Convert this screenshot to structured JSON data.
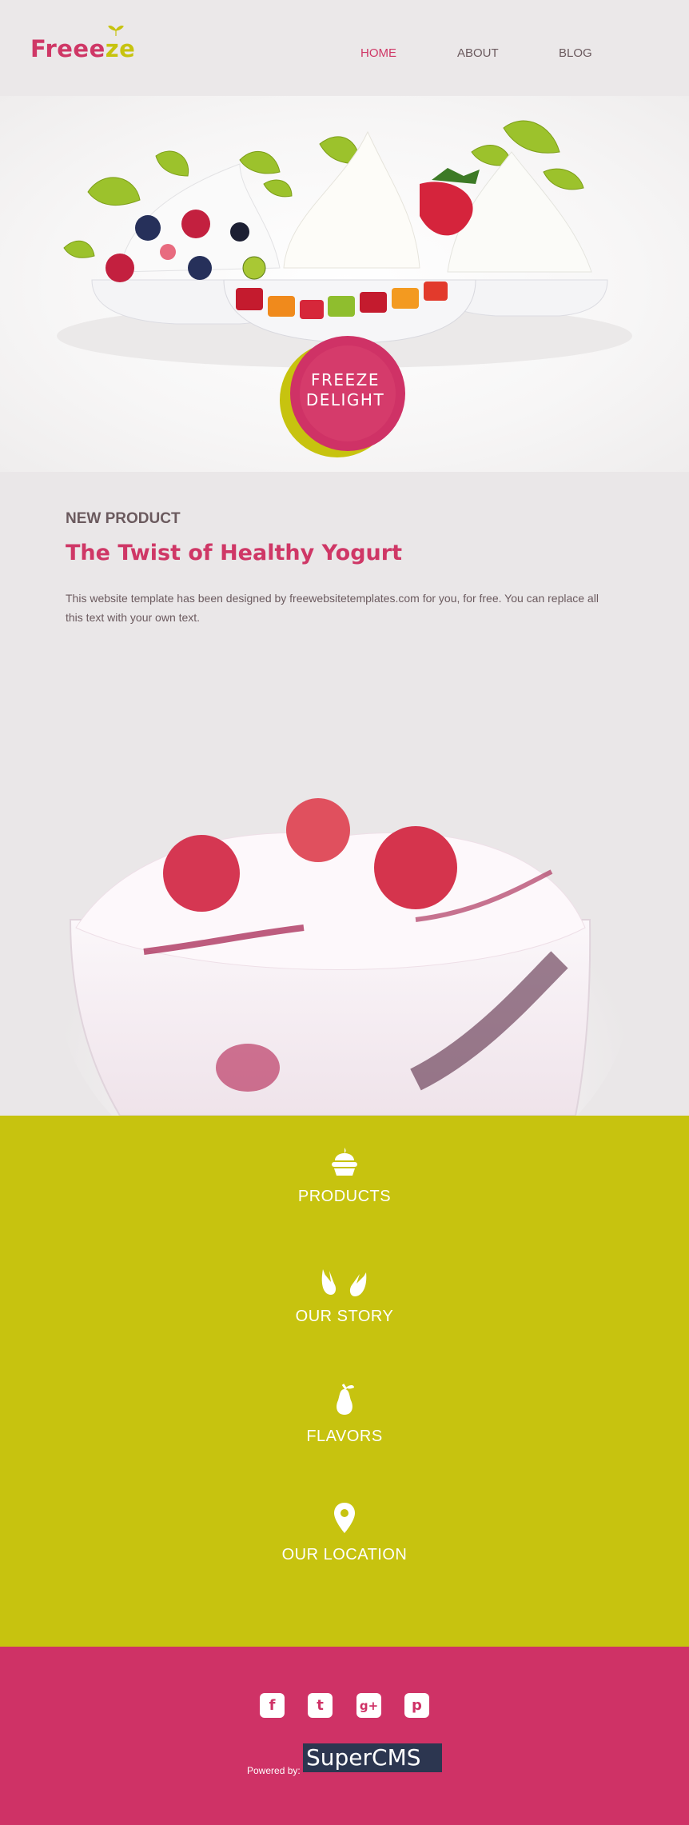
{
  "header": {
    "logo_main": "Freee",
    "logo_accent": "ze",
    "nav": [
      {
        "label": "HOME",
        "active": true
      },
      {
        "label": "ABOUT",
        "active": false
      },
      {
        "label": "BLOG",
        "active": false
      }
    ]
  },
  "hero": {
    "badge_line1": "FREEZE",
    "badge_line2": "DELIGHT"
  },
  "product": {
    "kicker": "NEW PRODUCT",
    "title": "The Twist of Healthy Yogurt",
    "description": "This website template has been designed by freewebsitetemplates.com for you, for free. You can replace all this text with your own text."
  },
  "links": [
    {
      "label": "PRODUCTS",
      "icon": "cupcake-icon"
    },
    {
      "label": "OUR STORY",
      "icon": "hands-icon"
    },
    {
      "label": "FLAVORS",
      "icon": "pear-icon"
    },
    {
      "label": "OUR LOCATION",
      "icon": "location-pin-icon"
    }
  ],
  "footer": {
    "social": [
      {
        "glyph": "f",
        "icon": "facebook-icon"
      },
      {
        "glyph": "t",
        "icon": "twitter-icon"
      },
      {
        "glyph": "g+",
        "icon": "googleplus-icon"
      },
      {
        "glyph": "p",
        "icon": "pinterest-icon"
      }
    ],
    "powered_by": "Powered by:",
    "cms_name": "SuperCMS"
  },
  "colors": {
    "brand_pink": "#cf3766",
    "brand_lime": "#c7c30f",
    "text": "#6b5a5e",
    "background": "#eae7e8"
  }
}
